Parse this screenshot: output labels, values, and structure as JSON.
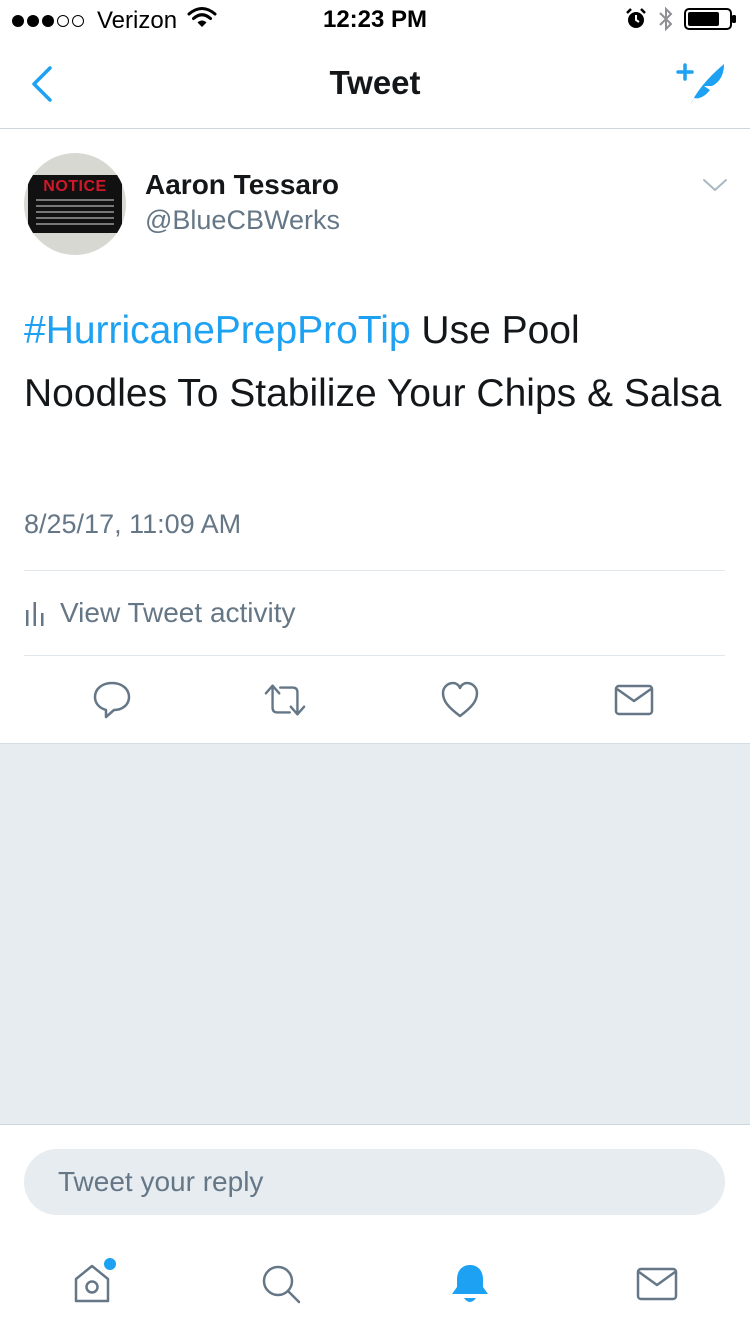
{
  "status_bar": {
    "carrier": "Verizon",
    "time": "12:23 PM",
    "signal_bars": 3,
    "signal_total": 5,
    "icons": [
      "wifi-icon",
      "alarm-icon",
      "bluetooth-icon",
      "battery-icon"
    ],
    "battery_level": 0.75
  },
  "nav": {
    "title": "Tweet",
    "back_icon": "chevron-left-icon",
    "compose_icon": "compose-tweet-icon"
  },
  "tweet": {
    "author": {
      "name": "Aaron Tessaro",
      "handle": "@BlueCBWerks",
      "avatar_sign_text": "NOTICE"
    },
    "hashtag": "#HurricanePrepProTip",
    "text": " Use Pool Noodles To Stabilize Your Chips & Salsa",
    "timestamp": "8/25/17, 11:09 AM",
    "activity_label": "View Tweet activity",
    "actions": [
      "reply-icon",
      "retweet-icon",
      "like-icon",
      "direct-message-icon"
    ]
  },
  "reply": {
    "placeholder": "Tweet your reply",
    "value": ""
  },
  "tabbar": {
    "tabs": [
      {
        "name": "home",
        "icon": "home-icon",
        "active": false,
        "notification_dot": true
      },
      {
        "name": "search",
        "icon": "search-icon",
        "active": false,
        "notification_dot": false
      },
      {
        "name": "notifications",
        "icon": "bell-icon",
        "active": true,
        "notification_dot": false
      },
      {
        "name": "messages",
        "icon": "mail-icon",
        "active": false,
        "notification_dot": false
      }
    ]
  },
  "colors": {
    "accent": "#1da1f2",
    "text_primary": "#14171a",
    "text_secondary": "#657786",
    "divider": "#e1e8ed",
    "background_gray": "#e6ecf0"
  }
}
